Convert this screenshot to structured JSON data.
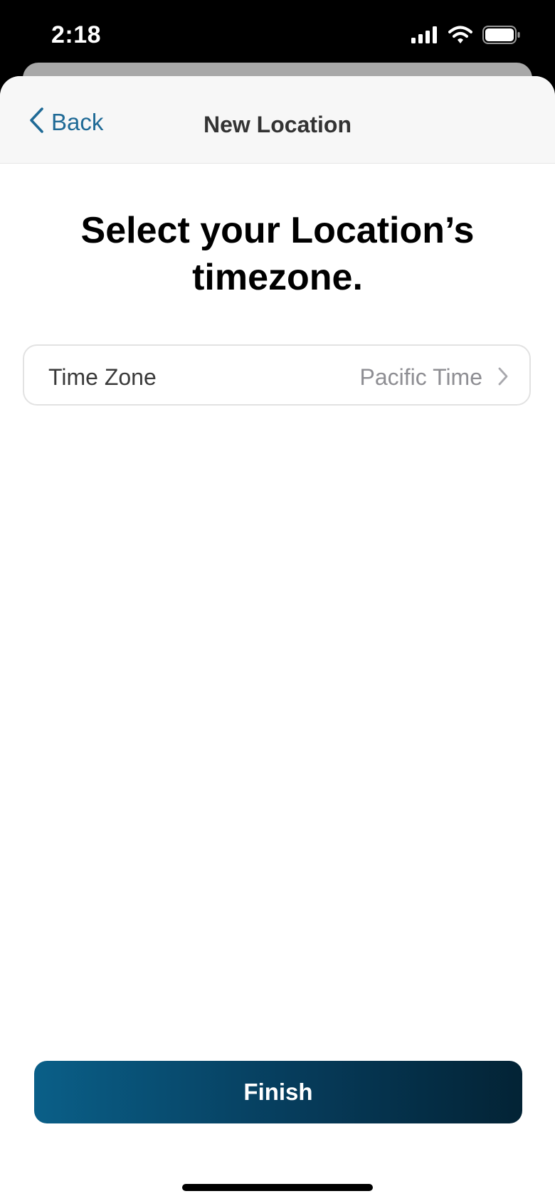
{
  "status_bar": {
    "time": "2:18",
    "icons": [
      "cellular-signal-icon",
      "wifi-icon",
      "battery-icon"
    ]
  },
  "nav": {
    "back_label": "Back",
    "title": "New Location"
  },
  "main": {
    "heading": "Select your Location’s timezone.",
    "time_zone_row": {
      "label": "Time Zone",
      "value": "Pacific Time"
    },
    "finish_label": "Finish"
  },
  "colors": {
    "accent": "#1f6a96",
    "button_gradient_start": "#0a5f88",
    "button_gradient_end": "#032335",
    "secondary_text": "#8e8e93"
  }
}
